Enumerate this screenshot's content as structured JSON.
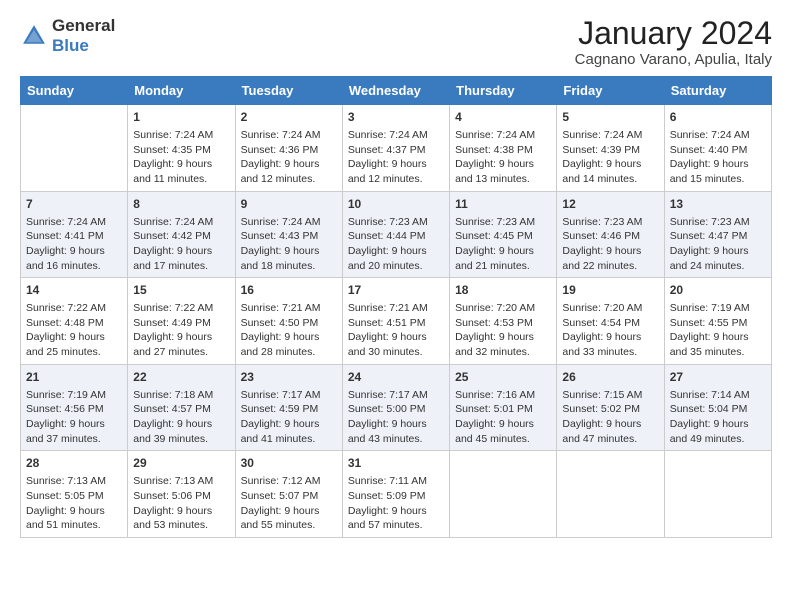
{
  "header": {
    "logo_general": "General",
    "logo_blue": "Blue",
    "title": "January 2024",
    "location": "Cagnano Varano, Apulia, Italy"
  },
  "weekdays": [
    "Sunday",
    "Monday",
    "Tuesday",
    "Wednesday",
    "Thursday",
    "Friday",
    "Saturday"
  ],
  "rows": [
    [
      {
        "day": "",
        "lines": []
      },
      {
        "day": "1",
        "lines": [
          "Sunrise: 7:24 AM",
          "Sunset: 4:35 PM",
          "Daylight: 9 hours",
          "and 11 minutes."
        ]
      },
      {
        "day": "2",
        "lines": [
          "Sunrise: 7:24 AM",
          "Sunset: 4:36 PM",
          "Daylight: 9 hours",
          "and 12 minutes."
        ]
      },
      {
        "day": "3",
        "lines": [
          "Sunrise: 7:24 AM",
          "Sunset: 4:37 PM",
          "Daylight: 9 hours",
          "and 12 minutes."
        ]
      },
      {
        "day": "4",
        "lines": [
          "Sunrise: 7:24 AM",
          "Sunset: 4:38 PM",
          "Daylight: 9 hours",
          "and 13 minutes."
        ]
      },
      {
        "day": "5",
        "lines": [
          "Sunrise: 7:24 AM",
          "Sunset: 4:39 PM",
          "Daylight: 9 hours",
          "and 14 minutes."
        ]
      },
      {
        "day": "6",
        "lines": [
          "Sunrise: 7:24 AM",
          "Sunset: 4:40 PM",
          "Daylight: 9 hours",
          "and 15 minutes."
        ]
      }
    ],
    [
      {
        "day": "7",
        "lines": [
          "Sunrise: 7:24 AM",
          "Sunset: 4:41 PM",
          "Daylight: 9 hours",
          "and 16 minutes."
        ]
      },
      {
        "day": "8",
        "lines": [
          "Sunrise: 7:24 AM",
          "Sunset: 4:42 PM",
          "Daylight: 9 hours",
          "and 17 minutes."
        ]
      },
      {
        "day": "9",
        "lines": [
          "Sunrise: 7:24 AM",
          "Sunset: 4:43 PM",
          "Daylight: 9 hours",
          "and 18 minutes."
        ]
      },
      {
        "day": "10",
        "lines": [
          "Sunrise: 7:23 AM",
          "Sunset: 4:44 PM",
          "Daylight: 9 hours",
          "and 20 minutes."
        ]
      },
      {
        "day": "11",
        "lines": [
          "Sunrise: 7:23 AM",
          "Sunset: 4:45 PM",
          "Daylight: 9 hours",
          "and 21 minutes."
        ]
      },
      {
        "day": "12",
        "lines": [
          "Sunrise: 7:23 AM",
          "Sunset: 4:46 PM",
          "Daylight: 9 hours",
          "and 22 minutes."
        ]
      },
      {
        "day": "13",
        "lines": [
          "Sunrise: 7:23 AM",
          "Sunset: 4:47 PM",
          "Daylight: 9 hours",
          "and 24 minutes."
        ]
      }
    ],
    [
      {
        "day": "14",
        "lines": [
          "Sunrise: 7:22 AM",
          "Sunset: 4:48 PM",
          "Daylight: 9 hours",
          "and 25 minutes."
        ]
      },
      {
        "day": "15",
        "lines": [
          "Sunrise: 7:22 AM",
          "Sunset: 4:49 PM",
          "Daylight: 9 hours",
          "and 27 minutes."
        ]
      },
      {
        "day": "16",
        "lines": [
          "Sunrise: 7:21 AM",
          "Sunset: 4:50 PM",
          "Daylight: 9 hours",
          "and 28 minutes."
        ]
      },
      {
        "day": "17",
        "lines": [
          "Sunrise: 7:21 AM",
          "Sunset: 4:51 PM",
          "Daylight: 9 hours",
          "and 30 minutes."
        ]
      },
      {
        "day": "18",
        "lines": [
          "Sunrise: 7:20 AM",
          "Sunset: 4:53 PM",
          "Daylight: 9 hours",
          "and 32 minutes."
        ]
      },
      {
        "day": "19",
        "lines": [
          "Sunrise: 7:20 AM",
          "Sunset: 4:54 PM",
          "Daylight: 9 hours",
          "and 33 minutes."
        ]
      },
      {
        "day": "20",
        "lines": [
          "Sunrise: 7:19 AM",
          "Sunset: 4:55 PM",
          "Daylight: 9 hours",
          "and 35 minutes."
        ]
      }
    ],
    [
      {
        "day": "21",
        "lines": [
          "Sunrise: 7:19 AM",
          "Sunset: 4:56 PM",
          "Daylight: 9 hours",
          "and 37 minutes."
        ]
      },
      {
        "day": "22",
        "lines": [
          "Sunrise: 7:18 AM",
          "Sunset: 4:57 PM",
          "Daylight: 9 hours",
          "and 39 minutes."
        ]
      },
      {
        "day": "23",
        "lines": [
          "Sunrise: 7:17 AM",
          "Sunset: 4:59 PM",
          "Daylight: 9 hours",
          "and 41 minutes."
        ]
      },
      {
        "day": "24",
        "lines": [
          "Sunrise: 7:17 AM",
          "Sunset: 5:00 PM",
          "Daylight: 9 hours",
          "and 43 minutes."
        ]
      },
      {
        "day": "25",
        "lines": [
          "Sunrise: 7:16 AM",
          "Sunset: 5:01 PM",
          "Daylight: 9 hours",
          "and 45 minutes."
        ]
      },
      {
        "day": "26",
        "lines": [
          "Sunrise: 7:15 AM",
          "Sunset: 5:02 PM",
          "Daylight: 9 hours",
          "and 47 minutes."
        ]
      },
      {
        "day": "27",
        "lines": [
          "Sunrise: 7:14 AM",
          "Sunset: 5:04 PM",
          "Daylight: 9 hours",
          "and 49 minutes."
        ]
      }
    ],
    [
      {
        "day": "28",
        "lines": [
          "Sunrise: 7:13 AM",
          "Sunset: 5:05 PM",
          "Daylight: 9 hours",
          "and 51 minutes."
        ]
      },
      {
        "day": "29",
        "lines": [
          "Sunrise: 7:13 AM",
          "Sunset: 5:06 PM",
          "Daylight: 9 hours",
          "and 53 minutes."
        ]
      },
      {
        "day": "30",
        "lines": [
          "Sunrise: 7:12 AM",
          "Sunset: 5:07 PM",
          "Daylight: 9 hours",
          "and 55 minutes."
        ]
      },
      {
        "day": "31",
        "lines": [
          "Sunrise: 7:11 AM",
          "Sunset: 5:09 PM",
          "Daylight: 9 hours",
          "and 57 minutes."
        ]
      },
      {
        "day": "",
        "lines": []
      },
      {
        "day": "",
        "lines": []
      },
      {
        "day": "",
        "lines": []
      }
    ]
  ]
}
